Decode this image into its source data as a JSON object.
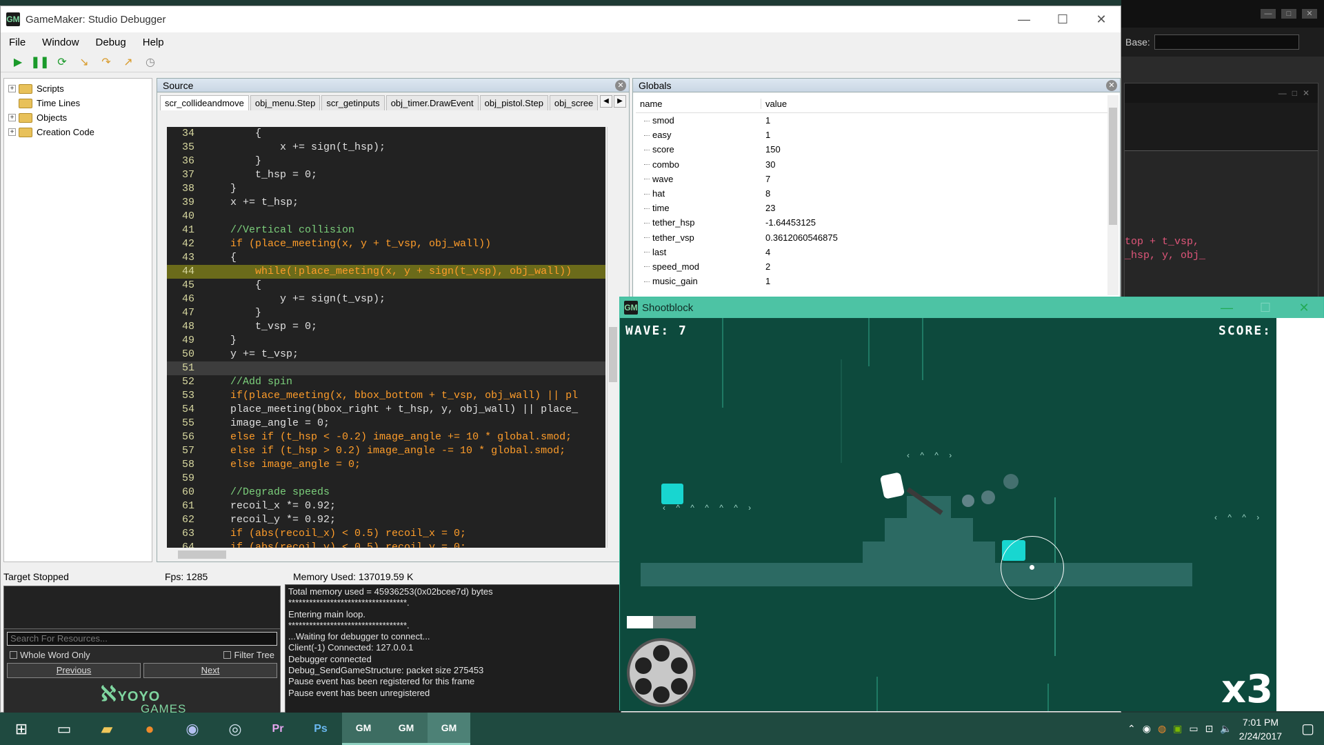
{
  "bg_window": {
    "base_label": "Base:",
    "code_lines": [
      "top + t_vsp, ",
      "_hsp, y, obj_"
    ]
  },
  "debugger": {
    "title": "GameMaker: Studio Debugger",
    "menu": [
      "File",
      "Window",
      "Debug",
      "Help"
    ],
    "tree": [
      "Scripts",
      "Time Lines",
      "Objects",
      "Creation Code"
    ],
    "source": {
      "header": "Source",
      "tabs": [
        "scr_collideandmove",
        "obj_menu.Step",
        "scr_getinputs",
        "obj_timer.DrawEvent",
        "obj_pistol.Step",
        "obj_scree"
      ],
      "lines": [
        {
          "n": "34",
          "t": "        {"
        },
        {
          "n": "35",
          "t": "            x += sign(t_hsp);"
        },
        {
          "n": "36",
          "t": "        }"
        },
        {
          "n": "37",
          "t": "        t_hsp = 0;"
        },
        {
          "n": "38",
          "t": "    }"
        },
        {
          "n": "39",
          "t": "    x += t_hsp;"
        },
        {
          "n": "40",
          "t": ""
        },
        {
          "n": "41",
          "t": "    //Vertical collision"
        },
        {
          "n": "42",
          "t": "    if (place_meeting(x, y + t_vsp, obj_wall))"
        },
        {
          "n": "43",
          "t": "    {"
        },
        {
          "n": "44",
          "t": "        while(!place_meeting(x, y + sign(t_vsp), obj_wall))"
        },
        {
          "n": "45",
          "t": "        {"
        },
        {
          "n": "46",
          "t": "            y += sign(t_vsp);"
        },
        {
          "n": "47",
          "t": "        }"
        },
        {
          "n": "48",
          "t": "        t_vsp = 0;"
        },
        {
          "n": "49",
          "t": "    }"
        },
        {
          "n": "50",
          "t": "    y += t_vsp;"
        },
        {
          "n": "51",
          "t": ""
        },
        {
          "n": "52",
          "t": "    //Add spin"
        },
        {
          "n": "53",
          "t": "    if(place_meeting(x, bbox_bottom + t_vsp, obj_wall) || pl"
        },
        {
          "n": "54",
          "t": "    place_meeting(bbox_right + t_hsp, y, obj_wall) || place_"
        },
        {
          "n": "55",
          "t": "    image_angle = 0;"
        },
        {
          "n": "56",
          "t": "    else if (t_hsp < -0.2) image_angle += 10 * global.smod;"
        },
        {
          "n": "57",
          "t": "    else if (t_hsp > 0.2) image_angle -= 10 * global.smod;"
        },
        {
          "n": "58",
          "t": "    else image_angle = 0;"
        },
        {
          "n": "59",
          "t": ""
        },
        {
          "n": "60",
          "t": "    //Degrade speeds"
        },
        {
          "n": "61",
          "t": "    recoil_x *= 0.92;"
        },
        {
          "n": "62",
          "t": "    recoil_y *= 0.92;"
        },
        {
          "n": "63",
          "t": "    if (abs(recoil_x) < 0.5) recoil_x = 0;"
        },
        {
          "n": "64",
          "t": "    if (abs(recoil_y) < 0.5) recoil_y = 0;"
        }
      ],
      "highlight_line": "44",
      "current_line": "51"
    },
    "globals": {
      "header": "Globals",
      "col_name": "name",
      "col_value": "value",
      "rows": [
        {
          "name": "smod",
          "value": "1"
        },
        {
          "name": "easy",
          "value": "1"
        },
        {
          "name": "score",
          "value": "150"
        },
        {
          "name": "combo",
          "value": "30"
        },
        {
          "name": "wave",
          "value": "7"
        },
        {
          "name": "hat",
          "value": "8"
        },
        {
          "name": "time",
          "value": "23"
        },
        {
          "name": "tether_hsp",
          "value": "-1.64453125"
        },
        {
          "name": "tether_vsp",
          "value": "0.3612060546875"
        },
        {
          "name": "last",
          "value": "4"
        },
        {
          "name": "speed_mod",
          "value": "2"
        },
        {
          "name": "music_gain",
          "value": "1"
        }
      ]
    },
    "status": {
      "target": "Target Stopped",
      "fps": "Fps: 1285",
      "memory": "Memory Used: 137019.59 K"
    },
    "resources": {
      "search_placeholder": "Search For Resources...",
      "whole_word": "Whole Word Only",
      "filter_tree": "Filter Tree",
      "prev": "Previous",
      "next": "Next",
      "logo_line1": "YOYO",
      "logo_line2": "GAMES"
    },
    "log": [
      "Total memory used = 45936253(0x02bcee7d) bytes",
      "**********************************.",
      "Entering main loop.",
      "**********************************.",
      "...Waiting for debugger to connect...",
      "Client(-1) Connected: 127.0.0.1",
      "Debugger connected",
      "Debug_SendGameStructure: packet size 275453",
      "Pause event has been registered for this frame",
      "Pause event has been unregistered"
    ]
  },
  "game": {
    "title": "Shootblock",
    "wave": "WAVE: 7",
    "score": "SCORE:",
    "multiplier": "x3",
    "health_fraction": 0.38
  },
  "taskbar": {
    "apps": [
      "start-icon",
      "task-view-icon",
      "file-explorer-icon",
      "firefox-icon",
      "discord-icon",
      "steam-icon",
      "premiere-icon",
      "photoshop-icon",
      "gamemaker-icon",
      "gamemaker-icon",
      "gamemaker-debugger-icon"
    ],
    "time": "7:01 PM",
    "date": "2/24/2017"
  },
  "colors": {
    "editor_bg": "#222222",
    "highlight": "#6b6b1a",
    "game_bg": "#0d4a3d",
    "game_titlebar": "#4dc3a4",
    "cyan_block": "#18d6d0"
  }
}
